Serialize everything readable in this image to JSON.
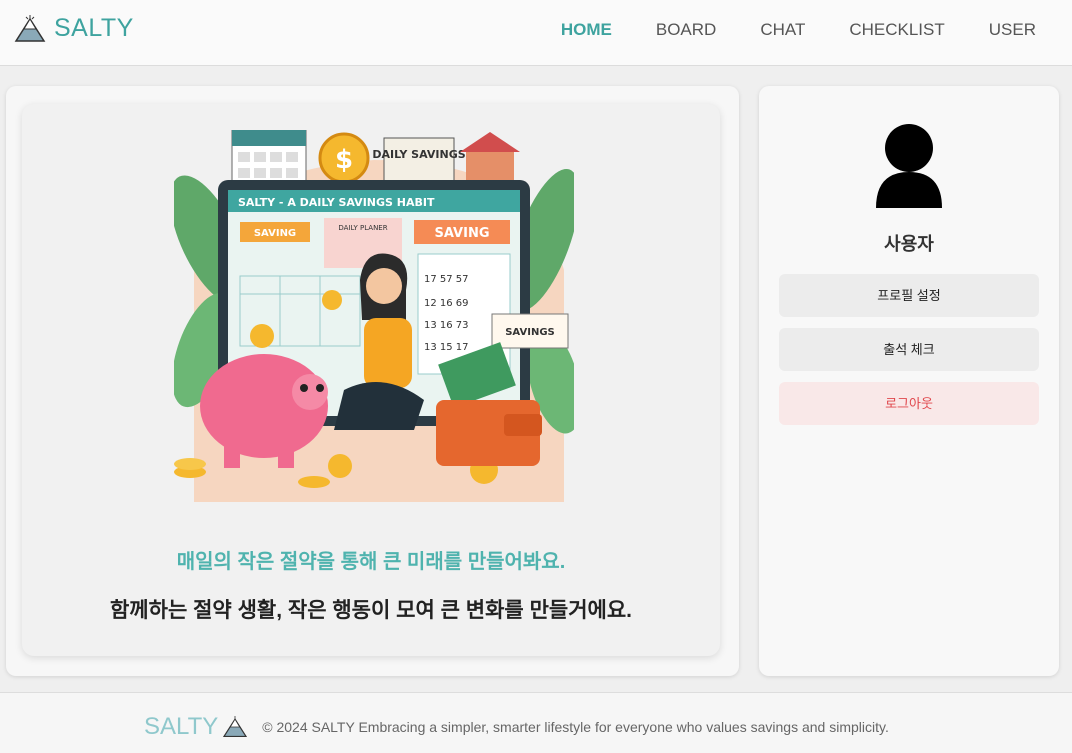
{
  "header": {
    "logo": "SALTY",
    "nav": [
      {
        "label": "HOME",
        "active": true
      },
      {
        "label": "BOARD",
        "active": false
      },
      {
        "label": "CHAT",
        "active": false
      },
      {
        "label": "CHECKLIST",
        "active": false
      },
      {
        "label": "USER",
        "active": false
      }
    ]
  },
  "hero": {
    "illustration_title": "SALTY - A DAILY SAVINGS HABIT",
    "illustration_labels": {
      "daily_savings_sign": "DAILY SAVINGS",
      "saving_left": "SAVING",
      "daily_planer": "DAILY PLANER",
      "saving_right": "SAVING",
      "savings_card": "SAVINGS"
    },
    "tagline": "매일의 작은 절약을 통해 큰 미래를 만들어봐요.",
    "subline": "함께하는 절약 생활, 작은 행동이 모여 큰 변화를 만들거에요."
  },
  "profile": {
    "username": "사용자",
    "buttons": {
      "profile_settings": "프로필 설정",
      "attendance": "출석 체크",
      "logout": "로그아웃"
    }
  },
  "footer": {
    "logo": "SALTY",
    "text": "© 2024 SALTY Embracing a simpler, smarter lifestyle for everyone who values savings and simplicity."
  },
  "colors": {
    "accent": "#3ea39f",
    "logout": "#e0474c"
  }
}
